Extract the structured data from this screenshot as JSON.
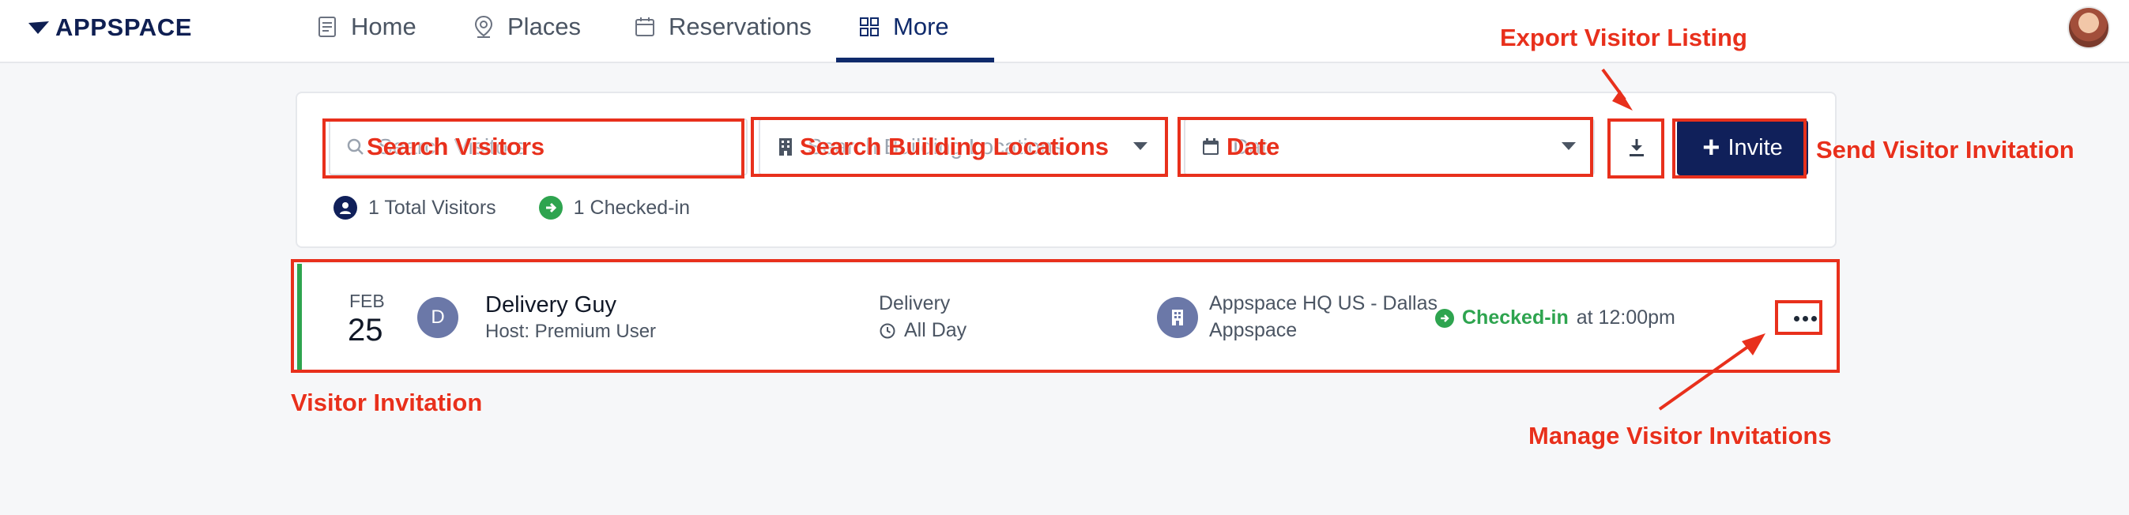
{
  "app": {
    "logo_text": "APPSPACE"
  },
  "nav": {
    "items": [
      {
        "label": "Home",
        "icon": "document-icon",
        "active": false
      },
      {
        "label": "Places",
        "icon": "location-pin-icon",
        "active": false
      },
      {
        "label": "Reservations",
        "icon": "calendar-icon",
        "active": false
      },
      {
        "label": "More",
        "icon": "grid-icon",
        "active": true
      }
    ]
  },
  "filters": {
    "search_placeholder": "Search Visitors",
    "building_placeholder": "Search Building Locations",
    "date_placeholder": "Date",
    "invite_label": "Invite"
  },
  "stats": {
    "total": "1 Total Visitors",
    "checked_in": "1 Checked-in"
  },
  "visitor": {
    "month": "FEB",
    "day": "25",
    "initial": "D",
    "name": "Delivery Guy",
    "host": "Host: Premium User",
    "type": "Delivery",
    "time": "All Day",
    "building": "Appspace HQ US - Dallas",
    "organization": "Appspace",
    "status": "Checked-in",
    "status_time": "at 12:00pm",
    "status_color": "#2ea44f"
  },
  "annotations": {
    "search_visitors": "Search Visitors",
    "search_building": "Search Building Locations",
    "date": "Date",
    "export": "Export Visitor Listing",
    "send_invitation": "Send Visitor Invitation",
    "visitor_invitation": "Visitor Invitation",
    "manage": "Manage Visitor Invitations",
    "color": "#e8301c"
  },
  "colors": {
    "brand": "#0f2a6b",
    "invite_button": "#10205a",
    "checked_in": "#2ea44f"
  }
}
